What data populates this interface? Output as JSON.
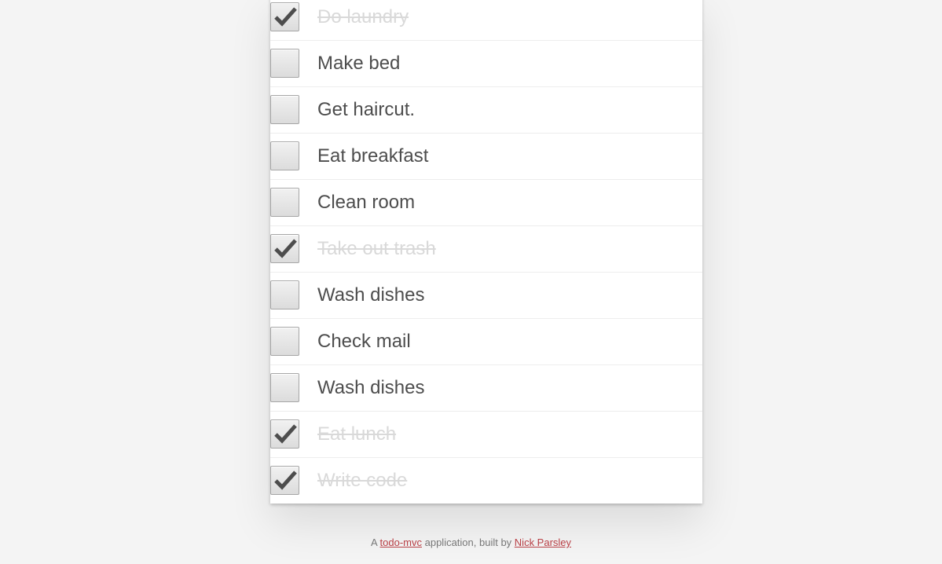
{
  "todos": [
    {
      "label": "Do laundry",
      "completed": true
    },
    {
      "label": "Make bed",
      "completed": false
    },
    {
      "label": "Get haircut.",
      "completed": false
    },
    {
      "label": "Eat breakfast",
      "completed": false
    },
    {
      "label": "Clean room",
      "completed": false
    },
    {
      "label": "Take out trash",
      "completed": true
    },
    {
      "label": "Wash dishes",
      "completed": false
    },
    {
      "label": "Check mail",
      "completed": false
    },
    {
      "label": "Wash dishes",
      "completed": false
    },
    {
      "label": "Eat lunch",
      "completed": true
    },
    {
      "label": "Write code",
      "completed": true
    }
  ],
  "footer": {
    "prefix": "A ",
    "app_link": "todo-mvc",
    "middle": " application, built by ",
    "author_link": "Nick Parsley"
  },
  "colors": {
    "background": "#f4f4f4",
    "panel": "#ffffff",
    "text": "#4d4d4d",
    "completed_text": "#d9d9d9",
    "link": "#b83f45"
  },
  "icons": {
    "toggle": "checkbox-icon",
    "check": "checkmark-icon"
  }
}
